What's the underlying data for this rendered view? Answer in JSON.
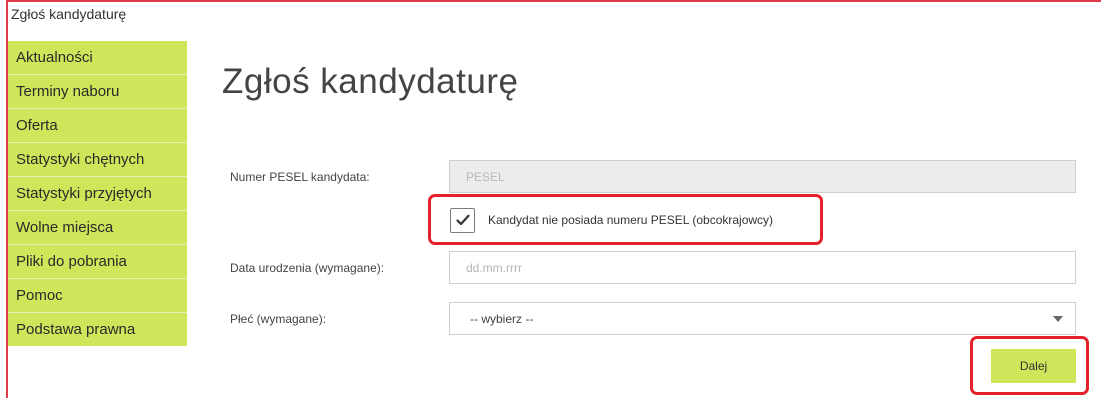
{
  "breadcrumb": {
    "current": "Zgłoś kandydaturę"
  },
  "sidebar": {
    "items": [
      {
        "label": "Aktualności"
      },
      {
        "label": "Terminy naboru"
      },
      {
        "label": "Oferta"
      },
      {
        "label": "Statystyki chętnych"
      },
      {
        "label": "Statystyki przyjętych"
      },
      {
        "label": "Wolne miejsca"
      },
      {
        "label": "Pliki do pobrania"
      },
      {
        "label": "Pomoc"
      },
      {
        "label": "Podstawa prawna"
      }
    ]
  },
  "main": {
    "title": "Zgłoś kandydaturę",
    "pesel": {
      "label": "Numer PESEL kandydata:",
      "placeholder": "PESEL",
      "disabled": true
    },
    "no_pesel": {
      "label": "Kandydat nie posiada numeru PESEL (obcokrajowcy)",
      "checked": true
    },
    "birth_date": {
      "label": "Data urodzenia (wymagane):",
      "placeholder": "dd.mm.rrrr"
    },
    "gender": {
      "label": "Płeć (wymagane):",
      "selected": "-- wybierz --"
    },
    "next_label": "Dalej"
  },
  "colors": {
    "accent": "#cfe55a",
    "highlight": "#e5222c",
    "frame": "#e23a4a"
  }
}
